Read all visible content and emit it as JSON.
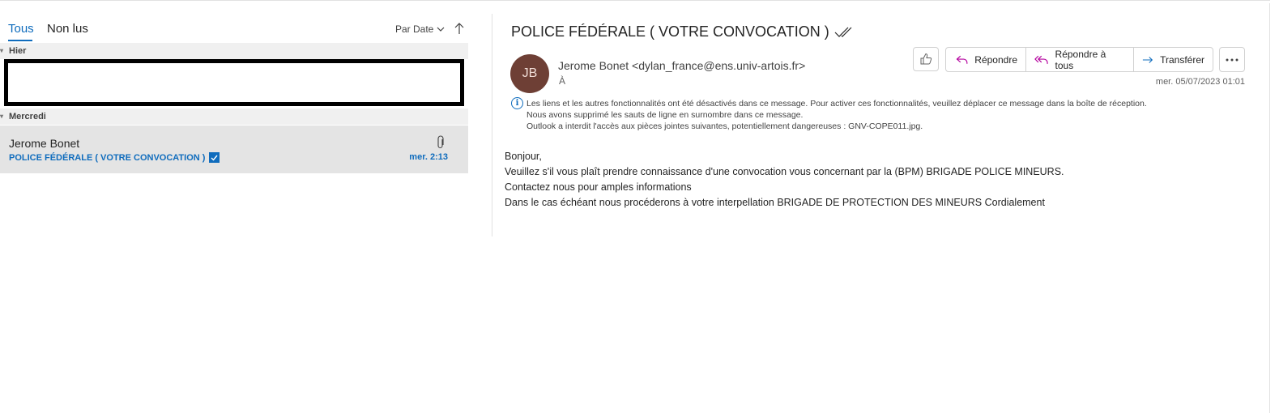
{
  "list": {
    "tabs": {
      "all": "Tous",
      "unread": "Non lus"
    },
    "sort_label": "Par Date",
    "groups": {
      "yesterday": "Hier",
      "wednesday": "Mercredi"
    },
    "item": {
      "sender": "Jerome Bonet",
      "subject": "POLICE FÉDÉRALE ( VOTRE CONVOCATION )",
      "time": "mer. 2:13"
    }
  },
  "message": {
    "subject": "POLICE FÉDÉRALE ( VOTRE CONVOCATION )",
    "avatar_initials": "JB",
    "from": "Jerome Bonet <dylan_france@ens.univ-artois.fr>",
    "to_label": "À",
    "date": "mer. 05/07/2023 01:01",
    "actions": {
      "reply": "Répondre",
      "reply_all": "Répondre à tous",
      "forward": "Transférer"
    },
    "info_lines": [
      "Les liens et les autres fonctionnalités ont été désactivés dans ce message. Pour activer ces fonctionnalités, veuillez déplacer ce message dans la boîte de réception.",
      "Nous avons supprimé les sauts de ligne en surnombre dans ce message.",
      "Outlook a interdit l'accès aux pièces jointes suivantes, potentiellement dangereuses : GNV-COPE011.jpg."
    ],
    "body_lines": [
      "Bonjour,",
      "Veuillez s'il vous plaît prendre connaissance  d'une convocation vous concernant par la (BPM) BRIGADE POLICE MINEURS.",
      "Contactez nous pour amples informations",
      "Dans le cas échéant nous procéderons à votre interpellation BRIGADE DE PROTECTION DES MINEURS Cordialement"
    ]
  },
  "colors": {
    "accent": "#0f6cbd",
    "avatar": "#6e3f35",
    "selected_row": "#e4e4e4",
    "reply_icon": "#b4009e"
  },
  "icons": [
    "sort-chevron-icon",
    "sort-arrow-icon",
    "attachment-icon",
    "checkbox-icon",
    "double-check-icon",
    "like-icon",
    "reply-icon",
    "reply-all-icon",
    "forward-icon",
    "more-icon",
    "info-icon"
  ]
}
